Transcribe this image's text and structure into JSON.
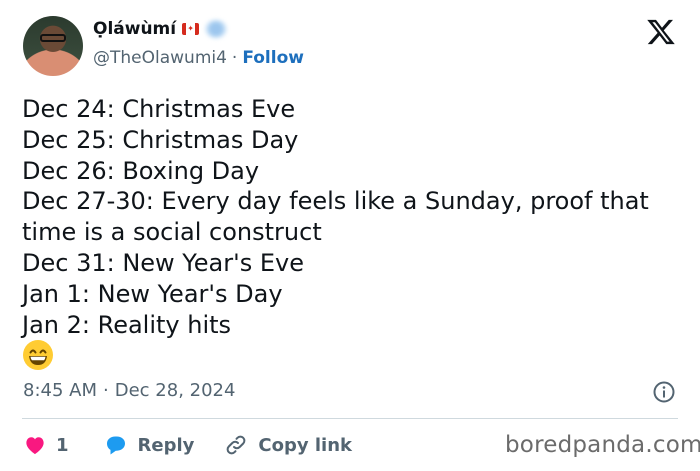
{
  "author": {
    "name": "Ọláwùmí",
    "handle": "@TheOlawumi4",
    "separator": "·",
    "follow_label": "Follow"
  },
  "tweet": {
    "lines": [
      "Dec 24: Christmas Eve",
      "Dec 25: Christmas Day",
      "Dec 26: Boxing Day",
      "Dec 27-30: Every day feels like a Sunday, proof that time is a social construct",
      "Dec 31: New Year's Eve",
      "Jan 1: New Year's Day",
      "Jan 2: Reality hits"
    ],
    "emoji_icon": "grinning-face-emoji"
  },
  "meta": {
    "time": "8:45 AM",
    "separator": "·",
    "date": "Dec 28, 2024"
  },
  "actions": {
    "like_count": "1",
    "reply_label": "Reply",
    "copy_label": "Copy link"
  },
  "watermark": "boredpanda.com",
  "colors": {
    "link_blue": "#1d6fbd",
    "like_pink": "#f91880",
    "reply_blue": "#1d9bf0",
    "muted": "#536471",
    "text": "#0f1419"
  }
}
